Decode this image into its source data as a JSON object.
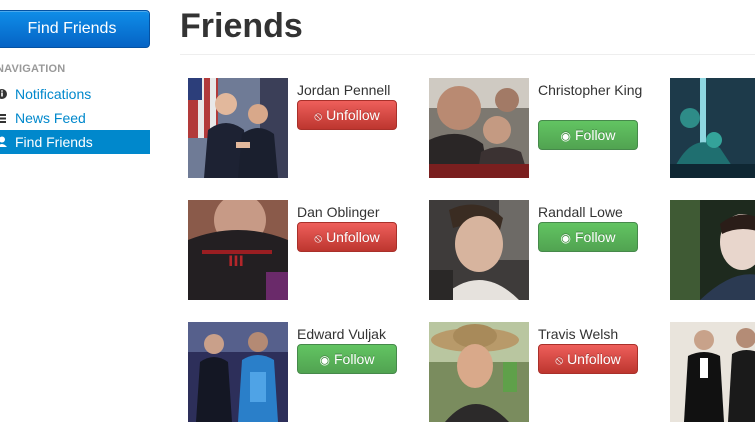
{
  "sidebar": {
    "find_button_label": "Find Friends",
    "nav_header": "NAVIGATION",
    "items": [
      {
        "label": "Notifications",
        "icon": "info-circle-icon",
        "active": false
      },
      {
        "label": "News Feed",
        "icon": "list-icon",
        "active": false
      },
      {
        "label": "Find Friends",
        "icon": "user-icon",
        "active": true
      }
    ]
  },
  "main": {
    "title": "Friends",
    "friends": [
      {
        "name": "Jordan Pennell",
        "action": "Unfollow"
      },
      {
        "name": "Christopher King",
        "action": "Follow"
      },
      {
        "name": "Dan Oblinger",
        "action": "Unfollow"
      },
      {
        "name": "Randall Lowe",
        "action": "Follow"
      },
      {
        "name": "Edward Vuljak",
        "action": "Follow"
      },
      {
        "name": "Travis Welsh",
        "action": "Unfollow"
      }
    ]
  },
  "colors": {
    "primary": "#0088cc",
    "follow": "#5bb75b",
    "unfollow": "#da4f49"
  }
}
